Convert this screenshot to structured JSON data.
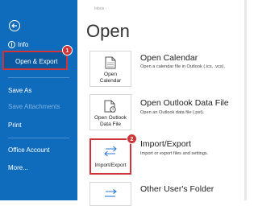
{
  "sidebar": {
    "info": "Info",
    "open_export": "Open & Export",
    "save_as": "Save As",
    "save_attachments": "Save Attachments",
    "print": "Print",
    "office_account": "Office Account",
    "more": "More..."
  },
  "breadcrumb": "Inbox -",
  "page_title": "Open",
  "options": [
    {
      "tile_label": "Open\nCalendar",
      "title": "Open Calendar",
      "desc": "Open a calendar file in Outlook (.ics, .vcs)."
    },
    {
      "tile_label": "Open Outlook\nData File",
      "title": "Open Outlook Data File",
      "desc": "Open an Outlook data file (.pst)."
    },
    {
      "tile_label": "Import/Export",
      "title": "Import/Export",
      "desc": "Import or export files and settings."
    },
    {
      "tile_label": "",
      "title": "Other User's Folder",
      "desc": ""
    }
  ],
  "badges": {
    "step1": "1",
    "step2": "2"
  },
  "colors": {
    "sidebar": "#0f6cbd",
    "highlight": "#d13438",
    "accent_icon": "#2b7cd3"
  }
}
